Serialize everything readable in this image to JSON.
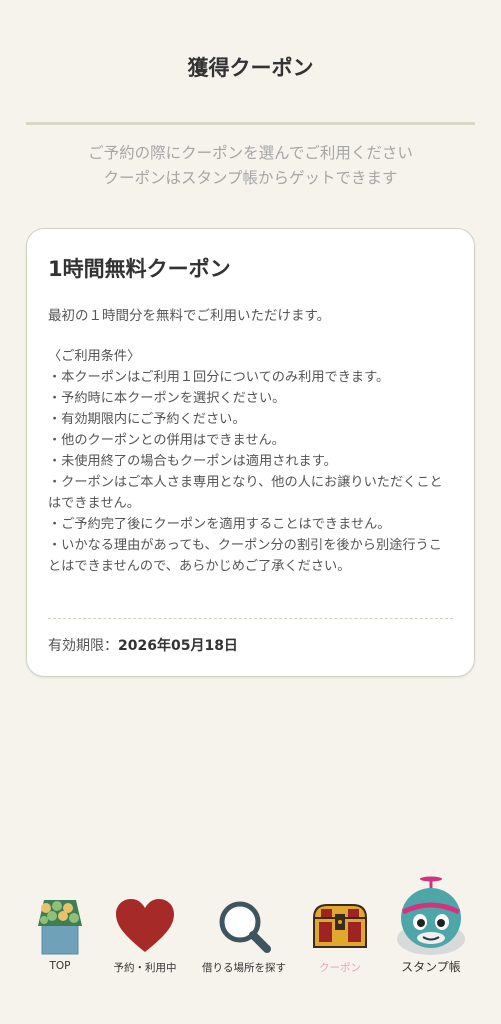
{
  "header": {
    "title": "獲得クーポン"
  },
  "subtitle": {
    "line1": "ご予約の際にクーポンを選んでご利用ください",
    "line2": "クーポンはスタンプ帳からゲットできます"
  },
  "coupon": {
    "title": "1時間無料クーポン",
    "description": "最初の１時間分を無料でご利用いただけます。",
    "conditions_heading": "〈ご利用条件〉",
    "conditions": [
      "・本クーポンはご利用１回分についてのみ利用できます。",
      "・予約時に本クーポンを選択ください。",
      "・有効期限内にご予約ください。",
      "・他のクーポンとの併用はできません。",
      "・未使用終了の場合もクーポンは適用されます。",
      "・クーポンはご本人さま専用となり、他の人にお譲りいただくことはできません。",
      "・ご予約完了後にクーポンを適用することはできません。",
      "・いかなる理由があっても、クーポン分の割引を後から別途行うことはできませんので、あらかじめご了承ください。"
    ],
    "expiry_label": "有効期限：",
    "expiry_value": "2026年05月18日"
  },
  "nav": {
    "items": [
      {
        "label": "TOP",
        "icon": "house-icon"
      },
      {
        "label": "予約・利用中",
        "icon": "heart-icon"
      },
      {
        "label": "借りる場所を探す",
        "icon": "search-icon"
      },
      {
        "label": "クーポン",
        "icon": "treasure-chest-icon",
        "active": true
      },
      {
        "label": "スタンプ帳",
        "icon": "mascot-icon"
      }
    ]
  },
  "colors": {
    "background": "#f5f3ec",
    "active_nav": "#ee9fb4",
    "heart": "#a62b28",
    "chest": "#e0a82e"
  }
}
